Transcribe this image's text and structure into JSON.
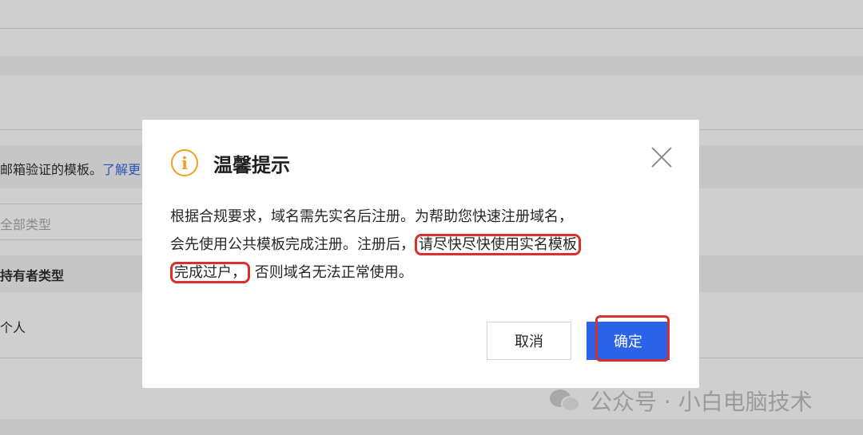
{
  "background": {
    "verify_text": "邮箱验证的模板。",
    "learn_more": "了解更",
    "type_filter_placeholder": "全部类型",
    "holder_type_header": "持有者类型",
    "holder_type_value": "个人"
  },
  "dialog": {
    "title": "温馨提示",
    "body_line1": "根据合规要求，域名需先实名后注册。为帮助您快速注册域名，",
    "body_line2_a": "会先使用公共模板完成注册。注册后，",
    "body_line2_hl": "请尽快尽快使用实名模板",
    "body_line3_hl": "完成过户，",
    "body_line3_b": "否则域名无法正常使用。",
    "cancel_label": "取消",
    "confirm_label": "确定"
  },
  "watermark": {
    "text": "公众号 · 小白电脑技术"
  },
  "colors": {
    "accent": "#2a62e8",
    "warning": "#f0a020",
    "highlight_border": "#d8302a"
  },
  "icons": [
    "info-icon",
    "close-icon",
    "wechat-icon"
  ]
}
